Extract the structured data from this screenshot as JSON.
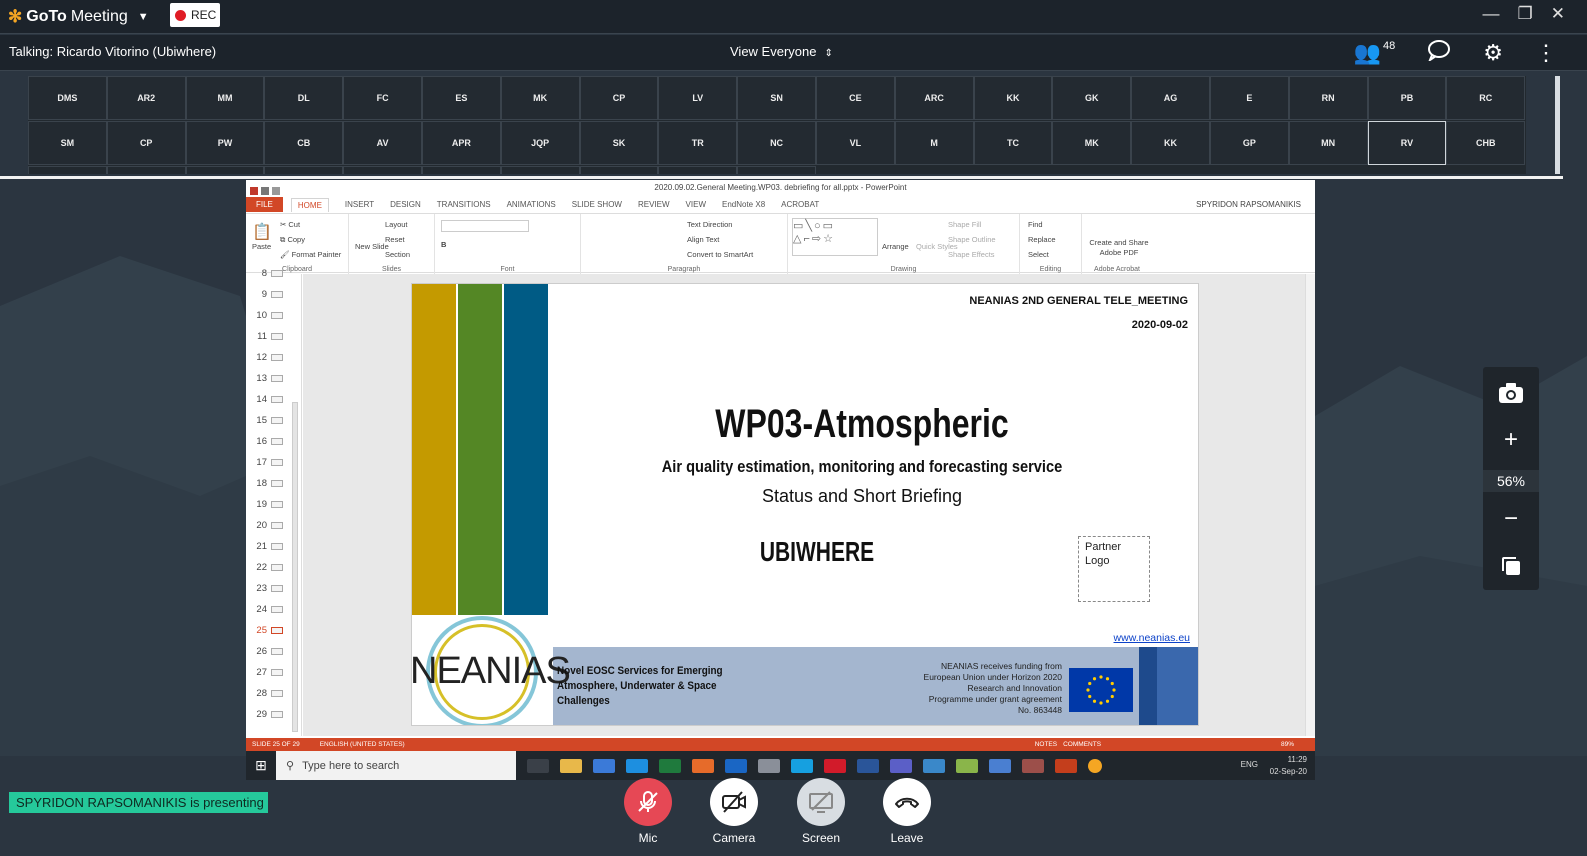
{
  "app": {
    "name_prefix": "GoTo",
    "name_suffix": "Meeting",
    "rec_label": "REC"
  },
  "window_controls": {
    "minimize": "—",
    "restore": "❐",
    "close": "✕"
  },
  "infobar": {
    "talking": "Talking: Ricardo Vitorino (Ubiwhere)",
    "view_label": "View Everyone",
    "attendee_count": "48"
  },
  "attendees_row1": [
    "DMS",
    "AR2",
    "MM",
    "DL",
    "FC",
    "ES",
    "MK",
    "CP",
    "LV",
    "SN",
    "CE",
    "ARC",
    "KK",
    "GK",
    "AG",
    "E",
    "RN",
    "PB",
    "RC"
  ],
  "attendees_row2": [
    "SM",
    "CP",
    "PW",
    "CB",
    "AV",
    "APR",
    "JQP",
    "SK",
    "TR",
    "NC",
    "VL",
    "M",
    "TC",
    "MK",
    "KK",
    "GP",
    "MN",
    "RV",
    "CHB"
  ],
  "selected_attendee": "RV",
  "powerpoint": {
    "window_title": "2020.09.02.General Meeting.WP03. debriefing for all.pptx - PowerPoint",
    "user": "SPYRIDON RAPSOMANIKIS",
    "tabs": [
      "FILE",
      "HOME",
      "INSERT",
      "DESIGN",
      "TRANSITIONS",
      "ANIMATIONS",
      "SLIDE SHOW",
      "REVIEW",
      "VIEW",
      "EndNote X8",
      "ACROBAT"
    ],
    "ribbon": {
      "clipboard": {
        "paste": "Paste",
        "cut": "Cut",
        "copy": "Copy",
        "format_painter": "Format Painter",
        "group": "Clipboard"
      },
      "slides": {
        "new_slide": "New Slide",
        "layout": "Layout",
        "reset": "Reset",
        "section": "Section",
        "group": "Slides"
      },
      "font": {
        "group": "Font"
      },
      "paragraph": {
        "text_direction": "Text Direction",
        "align_text": "Align Text",
        "convert": "Convert to SmartArt",
        "group": "Paragraph"
      },
      "drawing": {
        "arrange": "Arrange",
        "quick_styles": "Quick Styles",
        "shape_fill": "Shape Fill",
        "shape_outline": "Shape Outline",
        "shape_effects": "Shape Effects",
        "group": "Drawing"
      },
      "editing": {
        "find": "Find",
        "replace": "Replace",
        "select": "Select",
        "group": "Editing"
      },
      "acrobat": {
        "create": "Create and Share Adobe PDF",
        "group": "Adobe Acrobat"
      }
    },
    "slide_numbers": [
      "8",
      "9",
      "10",
      "11",
      "12",
      "13",
      "14",
      "15",
      "16",
      "17",
      "18",
      "19",
      "20",
      "21",
      "22",
      "23",
      "24",
      "25",
      "26",
      "27",
      "28",
      "29"
    ],
    "current_slide": "25",
    "status": {
      "slide_info": "SLIDE 25 OF 29",
      "language": "ENGLISH (UNITED STATES)",
      "notes": "NOTES",
      "comments": "COMMENTS",
      "zoom": "89%"
    }
  },
  "slide": {
    "header_line": "NEANIAS  2ND GENERAL  TELE_MEETING",
    "date": "2020-09-02",
    "title": "WP03-Atmospheric",
    "subtitle": "Air quality estimation, monitoring and forecasting service",
    "subtitle2": "Status and Short Briefing",
    "company": "UBIWHERE",
    "partner_logo": "Partner Logo",
    "url": "www.neanias.eu",
    "logo_text": "NEANIAS",
    "tagline_1": "Novel EOSC Services for Emerging",
    "tagline_2": "Atmosphere, Underwater & Space",
    "tagline_3": "Challenges",
    "funding_1": "NEANIAS receives funding from",
    "funding_2": "European Union under Horizon 2020",
    "funding_3": "Research and Innovation",
    "funding_4": "Programme under grant agreement",
    "funding_5": "No. 863448"
  },
  "taskbar": {
    "search_placeholder": "Type here to search",
    "lang": "ENG",
    "time": "11:29",
    "date": "02-Sep-20"
  },
  "side_panel": {
    "zoom": "56%"
  },
  "presenting": "SPYRIDON RAPSOMANIKIS is presenting",
  "controls": {
    "mic": "Mic",
    "camera": "Camera",
    "screen": "Screen",
    "leave": "Leave"
  },
  "colors": {
    "accent_orange": "#f5a623",
    "rec_red": "#e01c24",
    "mic_red": "#e64855",
    "present_green": "#25c99b",
    "ppt_orange": "#d24726"
  }
}
